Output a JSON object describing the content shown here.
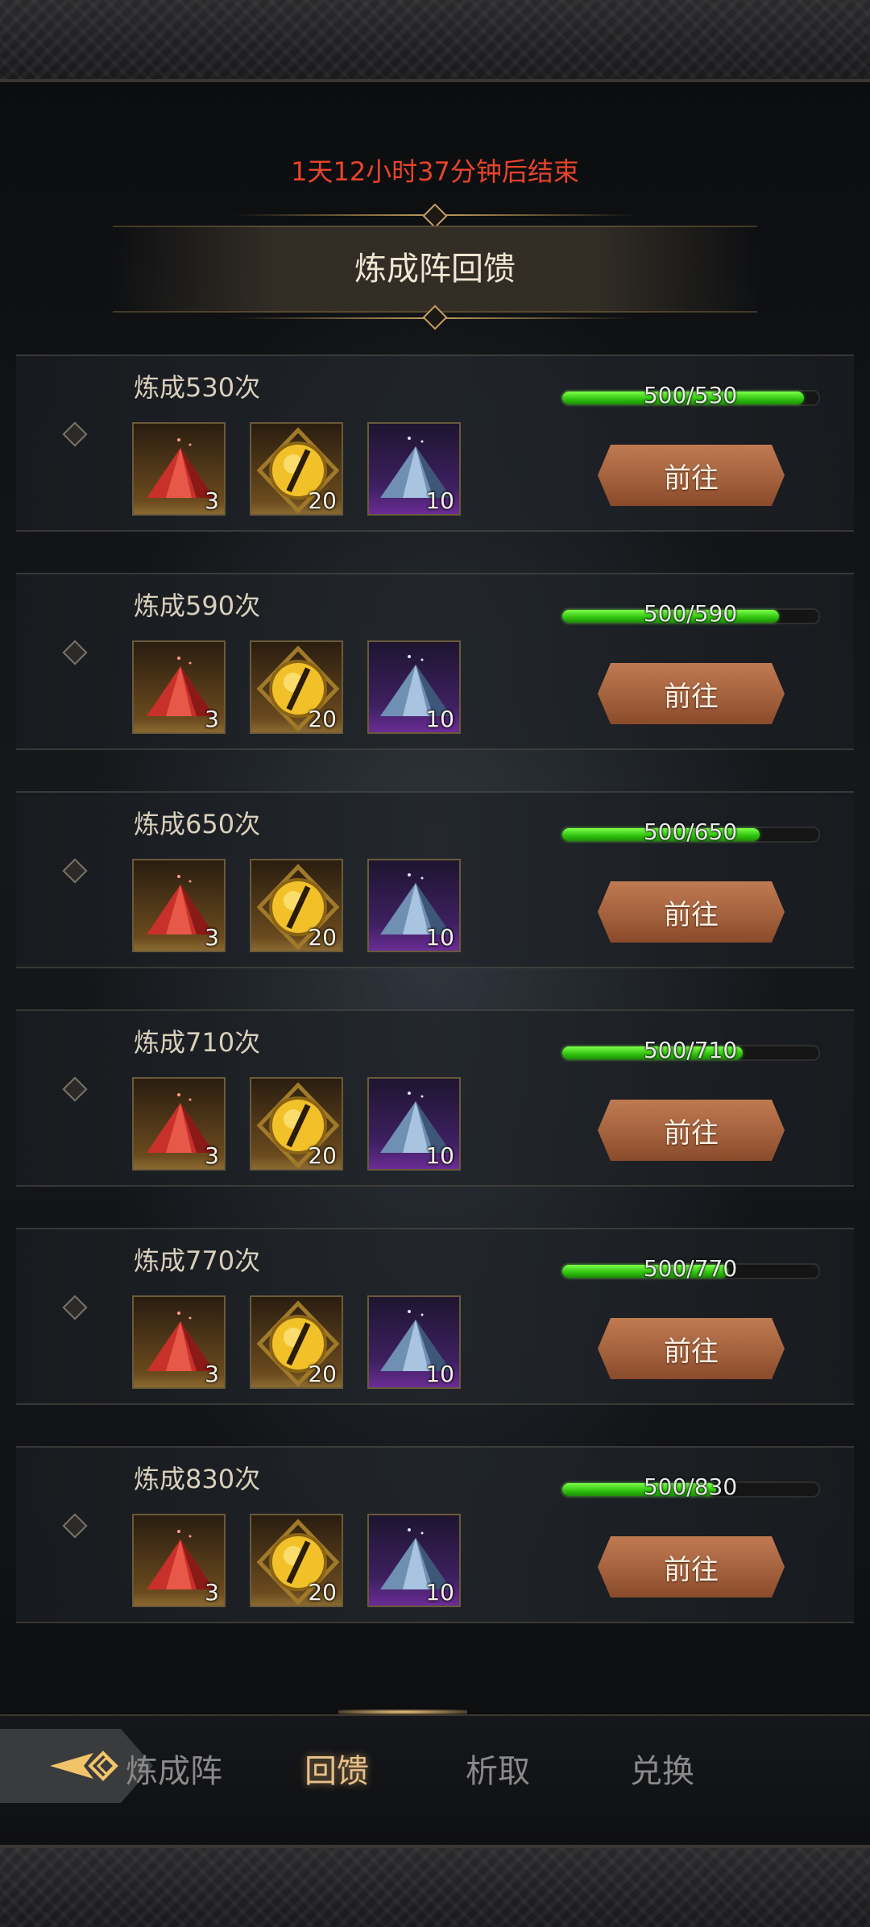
{
  "event": {
    "timer_text": "1天12小时37分钟后结束",
    "title": "炼成阵回馈"
  },
  "tasks": [
    {
      "label": "炼成530次",
      "progress_text": "500/530",
      "progress": 0.943,
      "rewards": [
        "3",
        "20",
        "10"
      ],
      "button": "前往"
    },
    {
      "label": "炼成590次",
      "progress_text": "500/590",
      "progress": 0.847,
      "rewards": [
        "3",
        "20",
        "10"
      ],
      "button": "前往"
    },
    {
      "label": "炼成650次",
      "progress_text": "500/650",
      "progress": 0.769,
      "rewards": [
        "3",
        "20",
        "10"
      ],
      "button": "前往"
    },
    {
      "label": "炼成710次",
      "progress_text": "500/710",
      "progress": 0.704,
      "rewards": [
        "3",
        "20",
        "10"
      ],
      "button": "前往"
    },
    {
      "label": "炼成770次",
      "progress_text": "500/770",
      "progress": 0.649,
      "rewards": [
        "3",
        "20",
        "10"
      ],
      "button": "前往"
    },
    {
      "label": "炼成830次",
      "progress_text": "500/830",
      "progress": 0.602,
      "rewards": [
        "3",
        "20",
        "10"
      ],
      "button": "前往"
    }
  ],
  "reward_icons": [
    "red-crystal-icon",
    "golden-eye-icon",
    "blue-crystal-icon"
  ],
  "nav": {
    "tabs": [
      "炼成阵",
      "回馈",
      "析取",
      "兑换"
    ],
    "active_index": 1
  },
  "colors": {
    "timer": "#e9442b",
    "progress_fill": "#2fc20e",
    "button": "#a15f3b",
    "active_tab": "#e7c089"
  }
}
